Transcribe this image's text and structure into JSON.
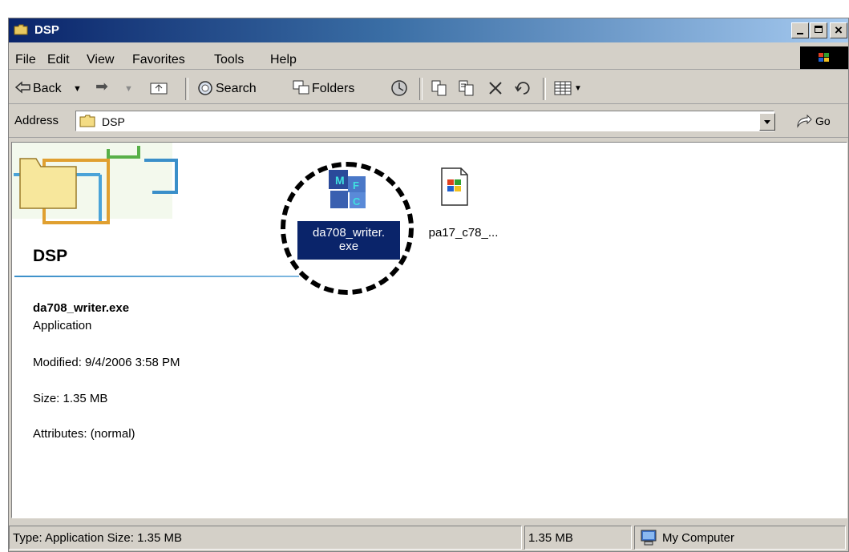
{
  "window": {
    "title": "DSP"
  },
  "menu": {
    "file": "File",
    "edit": "Edit",
    "view": "View",
    "favorites": "Favorites",
    "tools": "Tools",
    "help": "Help"
  },
  "toolbar": {
    "back": "Back",
    "search": "Search",
    "folders": "Folders"
  },
  "address": {
    "label": "Address",
    "value": "DSP",
    "go": "Go"
  },
  "sidebar": {
    "folder_title": "DSP",
    "selected_name": "da708_writer.exe",
    "selected_type": "Application",
    "modified": "Modified: 9/4/2006 3:58 PM",
    "size": "Size: 1.35 MB",
    "attributes": "Attributes: (normal)"
  },
  "files": [
    {
      "line1": "da708_writer.",
      "line2": "exe",
      "icon": "mfc-application-icon",
      "selected": true
    },
    {
      "line1": "pa17_c78_...",
      "icon": "windows-document-icon",
      "selected": false
    }
  ],
  "statusbar": {
    "info": "Type: Application Size: 1.35 MB",
    "size": "1.35 MB",
    "zone": "My Computer"
  },
  "colors": {
    "titlebar_start": "#0a246a",
    "titlebar_end": "#a6caf0",
    "selection": "#0a246a",
    "chrome": "#d4d0c8"
  }
}
